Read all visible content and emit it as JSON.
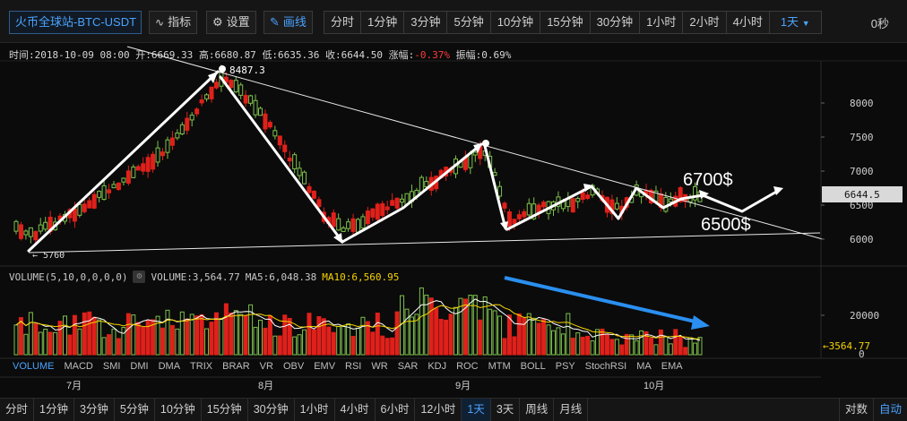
{
  "toolbar": {
    "symbol": "火币全球站-BTC-USDT",
    "indicator_label": "指标",
    "settings_label": "设置",
    "draw_label": "画线",
    "timeframes": [
      "分时",
      "1分钟",
      "3分钟",
      "5分钟",
      "10分钟",
      "15分钟",
      "30分钟",
      "1小时",
      "2小时",
      "4小时"
    ],
    "selected_timeframe": "1天",
    "countdown": "0秒"
  },
  "info": {
    "time": "时间:2018-10-09 08:00",
    "open": "开:6669.33",
    "high": "高:6680.87",
    "low": "低:6635.36",
    "close": "收:6644.50",
    "change_label": "涨幅:",
    "change_value": "-0.37%",
    "amplitude": "振幅:0.69%"
  },
  "price_axis": {
    "ticks": [
      "8000",
      "7500",
      "7000",
      "6500",
      "6000"
    ],
    "current_price": "6644.5"
  },
  "annotations": {
    "high_marker": "8487.3",
    "low_marker": "← 5760",
    "target_up": "6700$",
    "target_down": "6500$"
  },
  "volume": {
    "legend_title": "VOLUME(5,10,0,0,0,0)",
    "volume_value": "VOLUME:3,564.77",
    "ma5": "MA5:6,048.38",
    "ma10": "MA10:6,560.95",
    "axis_tick": "20000",
    "axis_zero": "0",
    "current_label": "←3564.77"
  },
  "indicators": [
    "VOLUME",
    "MACD",
    "SMI",
    "DMI",
    "DMA",
    "TRIX",
    "BRAR",
    "VR",
    "OBV",
    "EMV",
    "RSI",
    "WR",
    "SAR",
    "KDJ",
    "ROC",
    "MTM",
    "BOLL",
    "PSY",
    "StochRSI",
    "MA",
    "EMA"
  ],
  "time_axis": [
    "7月",
    "8月",
    "9月",
    "10月"
  ],
  "bottom_bar": {
    "items": [
      "分时",
      "1分钟",
      "3分钟",
      "5分钟",
      "10分钟",
      "15分钟",
      "30分钟",
      "1小时",
      "4小时",
      "6小时",
      "12小时",
      "1天",
      "3天",
      "周线",
      "月线"
    ],
    "selected": "1天",
    "log_label": "对数",
    "auto_label": "自动"
  },
  "colors": {
    "up": "#7cc04b",
    "down": "#e0201b",
    "ma5": "#ffffff",
    "ma10": "#f5d300",
    "accent": "#4aa3ff"
  }
}
